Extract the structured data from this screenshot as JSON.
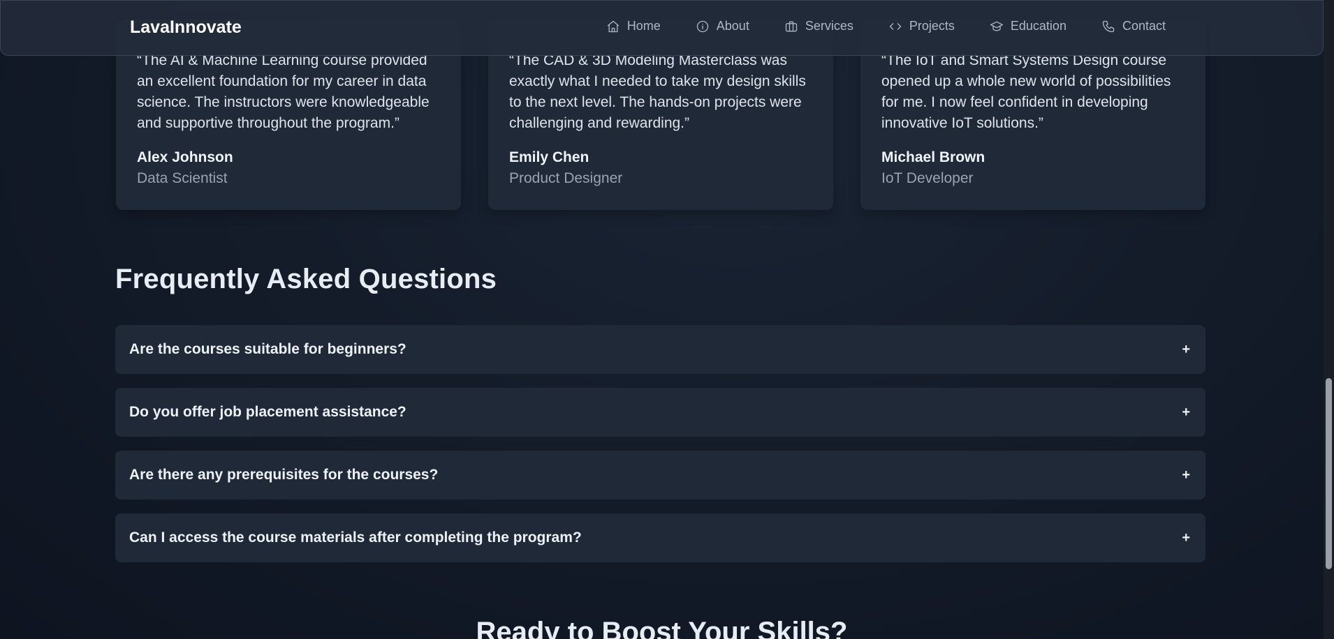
{
  "navbar": {
    "brand": "LavaInnovate",
    "links": [
      {
        "label": "Home",
        "icon": "home-icon"
      },
      {
        "label": "About",
        "icon": "info-icon"
      },
      {
        "label": "Services",
        "icon": "briefcase-icon"
      },
      {
        "label": "Projects",
        "icon": "code-icon"
      },
      {
        "label": "Education",
        "icon": "graduation-cap-icon"
      },
      {
        "label": "Contact",
        "icon": "phone-icon"
      }
    ]
  },
  "testimonials": [
    {
      "quote": "“The AI & Machine Learning course provided an excellent foundation for my career in data science. The instructors were knowledgeable and supportive throughout the program.”",
      "name": "Alex Johnson",
      "role": "Data Scientist"
    },
    {
      "quote": "“The CAD & 3D Modeling Masterclass was exactly what I needed to take my design skills to the next level. The hands-on projects were challenging and rewarding.”",
      "name": "Emily Chen",
      "role": "Product Designer"
    },
    {
      "quote": "“The IoT and Smart Systems Design course opened up a whole new world of possibilities for me. I now feel confident in developing innovative IoT solutions.”",
      "name": "Michael Brown",
      "role": "IoT Developer"
    }
  ],
  "faq": {
    "title": "Frequently Asked Questions",
    "toggle_symbol": "+",
    "items": [
      {
        "question": "Are the courses suitable for beginners?"
      },
      {
        "question": "Do you offer job placement assistance?"
      },
      {
        "question": "Are there any prerequisites for the courses?"
      },
      {
        "question": "Can I access the course materials after completing the program?"
      }
    ]
  },
  "cta": {
    "title": "Ready to Boost Your Skills?"
  },
  "colors": {
    "background": "#141c2a",
    "card": "#1f2937",
    "nav_text": "#aeb7c4"
  }
}
